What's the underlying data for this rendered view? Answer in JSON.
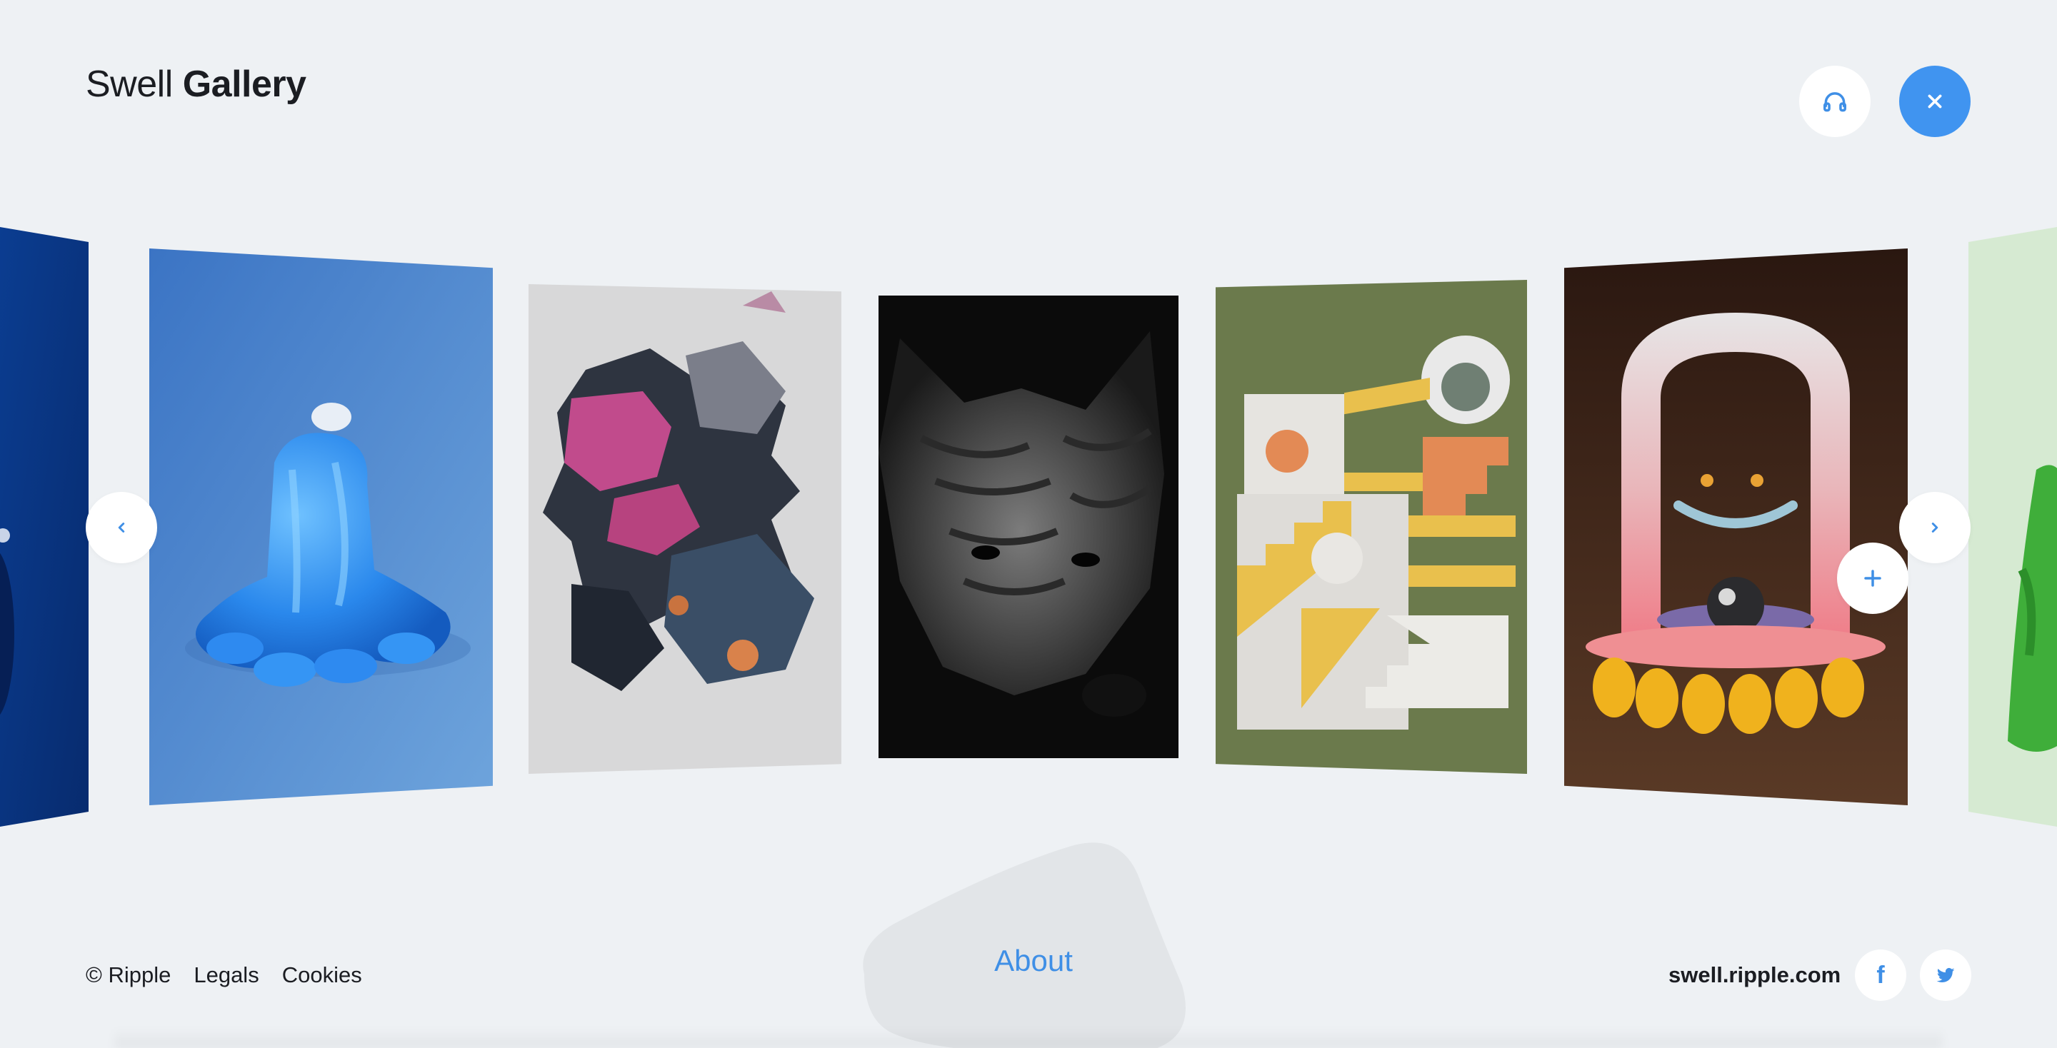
{
  "header": {
    "logo_light": "Swell",
    "logo_bold": "Gallery"
  },
  "controls": {
    "audio_icon": "headphones-icon",
    "close_icon": "close-icon",
    "prev_icon": "chevron-left-icon",
    "next_icon": "chevron-right-icon",
    "plus_icon": "plus-icon"
  },
  "gallery": {
    "artworks": [
      {
        "subject": "blue abstract",
        "bg": "#0b3d91"
      },
      {
        "subject": "blue inflatable sculpture",
        "bg": "#4a86cf"
      },
      {
        "subject": "abstract explosion",
        "bg": "#d7d7d7"
      },
      {
        "subject": "black wolf",
        "bg": "#0c0c0c"
      },
      {
        "subject": "geometric stairs",
        "bg": "#6c7c4d"
      },
      {
        "subject": "arch smile",
        "bg": "#3a2214"
      },
      {
        "subject": "green figure",
        "bg": "#d6ead2"
      }
    ]
  },
  "footer": {
    "copyright": "© Ripple",
    "legals": "Legals",
    "cookies": "Cookies",
    "about": "About",
    "site_url": "swell.ripple.com",
    "facebook": "f",
    "twitter_icon": "twitter-icon"
  },
  "colors": {
    "background": "#eef1f4",
    "accent": "#4094f0",
    "text": "#1b1d22"
  }
}
